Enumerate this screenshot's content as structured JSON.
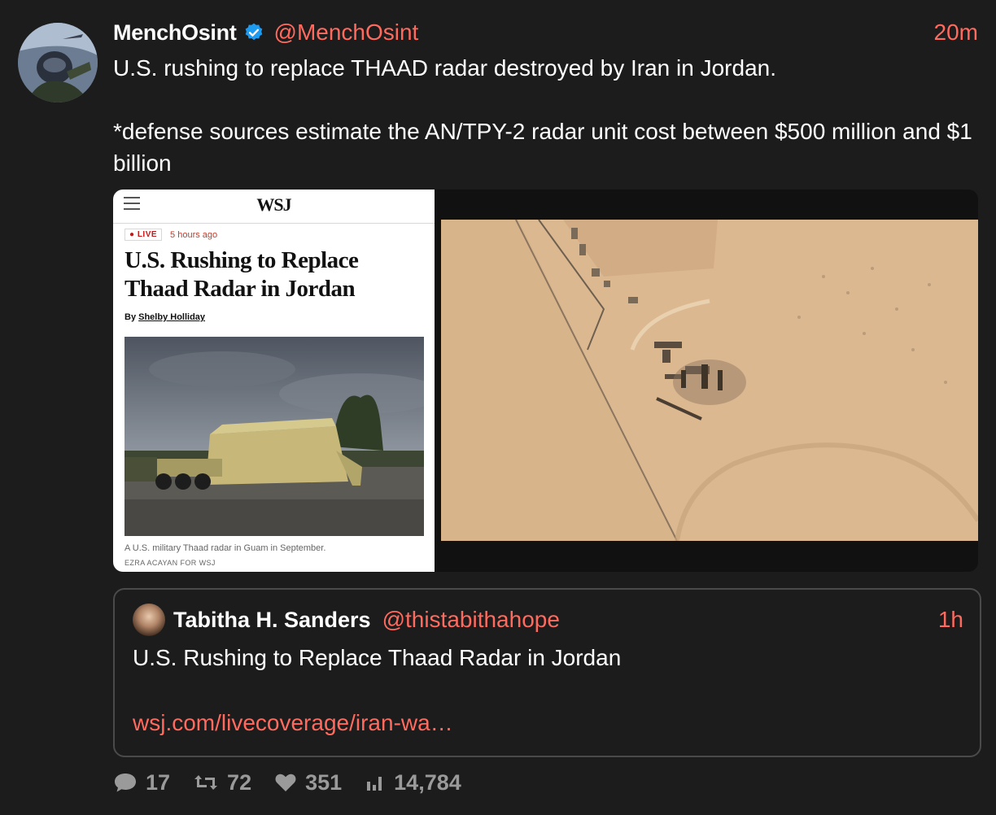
{
  "tweet": {
    "display_name": "MenchOsint",
    "handle": "@MenchOsint",
    "time": "20m",
    "text_line1": "U.S. rushing to replace THAAD radar destroyed by Iran in Jordan.",
    "text_line2": "*defense sources estimate the AN/TPY-2 radar unit cost between $500 million and $1 billion"
  },
  "wsj_card": {
    "logo": "WSJ",
    "live_label": "● LIVE",
    "time_ago": "5 hours ago",
    "headline": "U.S. Rushing to Replace Thaad Radar in Jordan",
    "byline_prefix": "By",
    "author": "Shelby Holliday",
    "caption": "A U.S. military Thaad radar in Guam in September.",
    "credit": "EZRA ACAYAN FOR WSJ"
  },
  "quote": {
    "display_name": "Tabitha H. Sanders",
    "handle": "@thistabithahope",
    "time": "1h",
    "text": "U.S. Rushing to Replace Thaad Radar in Jordan",
    "link": "wsj.com/livecoverage/iran-wa…"
  },
  "actions": {
    "replies": "17",
    "reposts": "72",
    "likes": "351",
    "views": "14,784"
  },
  "colors": {
    "background": "#1c1c1c",
    "accent": "#ff6a5e",
    "verified": "#1d9bf0",
    "muted": "#9a9a9a"
  }
}
